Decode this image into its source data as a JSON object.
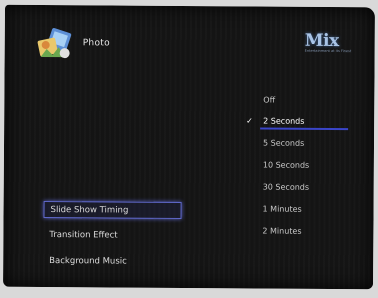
{
  "header": {
    "title": "Photo",
    "icon": "photo-app-icon"
  },
  "brand": {
    "logo_text": "Mix",
    "tagline": "Entertainment at its Finest"
  },
  "menu": {
    "items": [
      {
        "label": "Slide Show Timing",
        "selected": true
      },
      {
        "label": "Transition Effect",
        "selected": false
      },
      {
        "label": "Background Music",
        "selected": false
      }
    ]
  },
  "options": {
    "items": [
      {
        "label": "Off",
        "checked": false
      },
      {
        "label": "2 Seconds",
        "checked": true
      },
      {
        "label": "5 Seconds",
        "checked": false
      },
      {
        "label": "10 Seconds",
        "checked": false
      },
      {
        "label": "30 Seconds",
        "checked": false
      },
      {
        "label": "1 Minutes",
        "checked": false
      },
      {
        "label": "2 Minutes",
        "checked": false
      }
    ],
    "check_glyph": "✓"
  },
  "colors": {
    "background": "#141414",
    "highlight_border": "#5f68c9",
    "option_underline": "#3a45c8",
    "brand": "#a9c4e6"
  }
}
